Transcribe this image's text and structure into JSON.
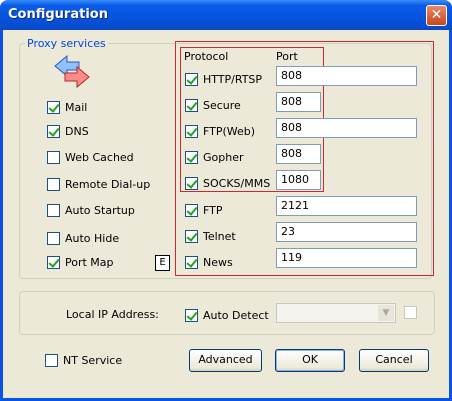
{
  "window": {
    "title": "Configuration",
    "close_glyph": "✕"
  },
  "proxy_services": {
    "legend": "Proxy services",
    "icon": "transfer-arrows-icon",
    "items": [
      {
        "label": "Mail",
        "checked": true
      },
      {
        "label": "DNS",
        "checked": true
      },
      {
        "label": "Web Cached",
        "checked": false
      },
      {
        "label": "Remote Dial-up",
        "checked": false
      },
      {
        "label": "Auto Startup",
        "checked": false
      },
      {
        "label": "Auto Hide",
        "checked": false
      },
      {
        "label": "Port Map",
        "checked": true
      }
    ],
    "port_map_badge": "E"
  },
  "protocols": {
    "header_protocol": "Protocol",
    "header_port": "Port",
    "rows": [
      {
        "label": "HTTP/RTSP",
        "checked": true,
        "port": "808"
      },
      {
        "label": "Secure",
        "checked": true,
        "port": "808"
      },
      {
        "label": "FTP(Web)",
        "checked": true,
        "port": "808"
      },
      {
        "label": "Gopher",
        "checked": true,
        "port": "808"
      },
      {
        "label": "SOCKS/MMS",
        "checked": true,
        "port": "1080"
      },
      {
        "label": "FTP",
        "checked": true,
        "port": "2121"
      },
      {
        "label": "Telnet",
        "checked": true,
        "port": "23"
      },
      {
        "label": "News",
        "checked": true,
        "port": "119"
      }
    ],
    "highlight_color": "#cc2a2a"
  },
  "local_ip": {
    "label": "Local IP Address:",
    "auto_detect_label": "Auto Detect",
    "auto_detect_checked": true,
    "address_value": "",
    "extra_checked": false
  },
  "footer": {
    "nt_service_label": "NT Service",
    "nt_service_checked": false,
    "advanced_label": "Advanced",
    "ok_label": "OK",
    "cancel_label": "Cancel"
  }
}
